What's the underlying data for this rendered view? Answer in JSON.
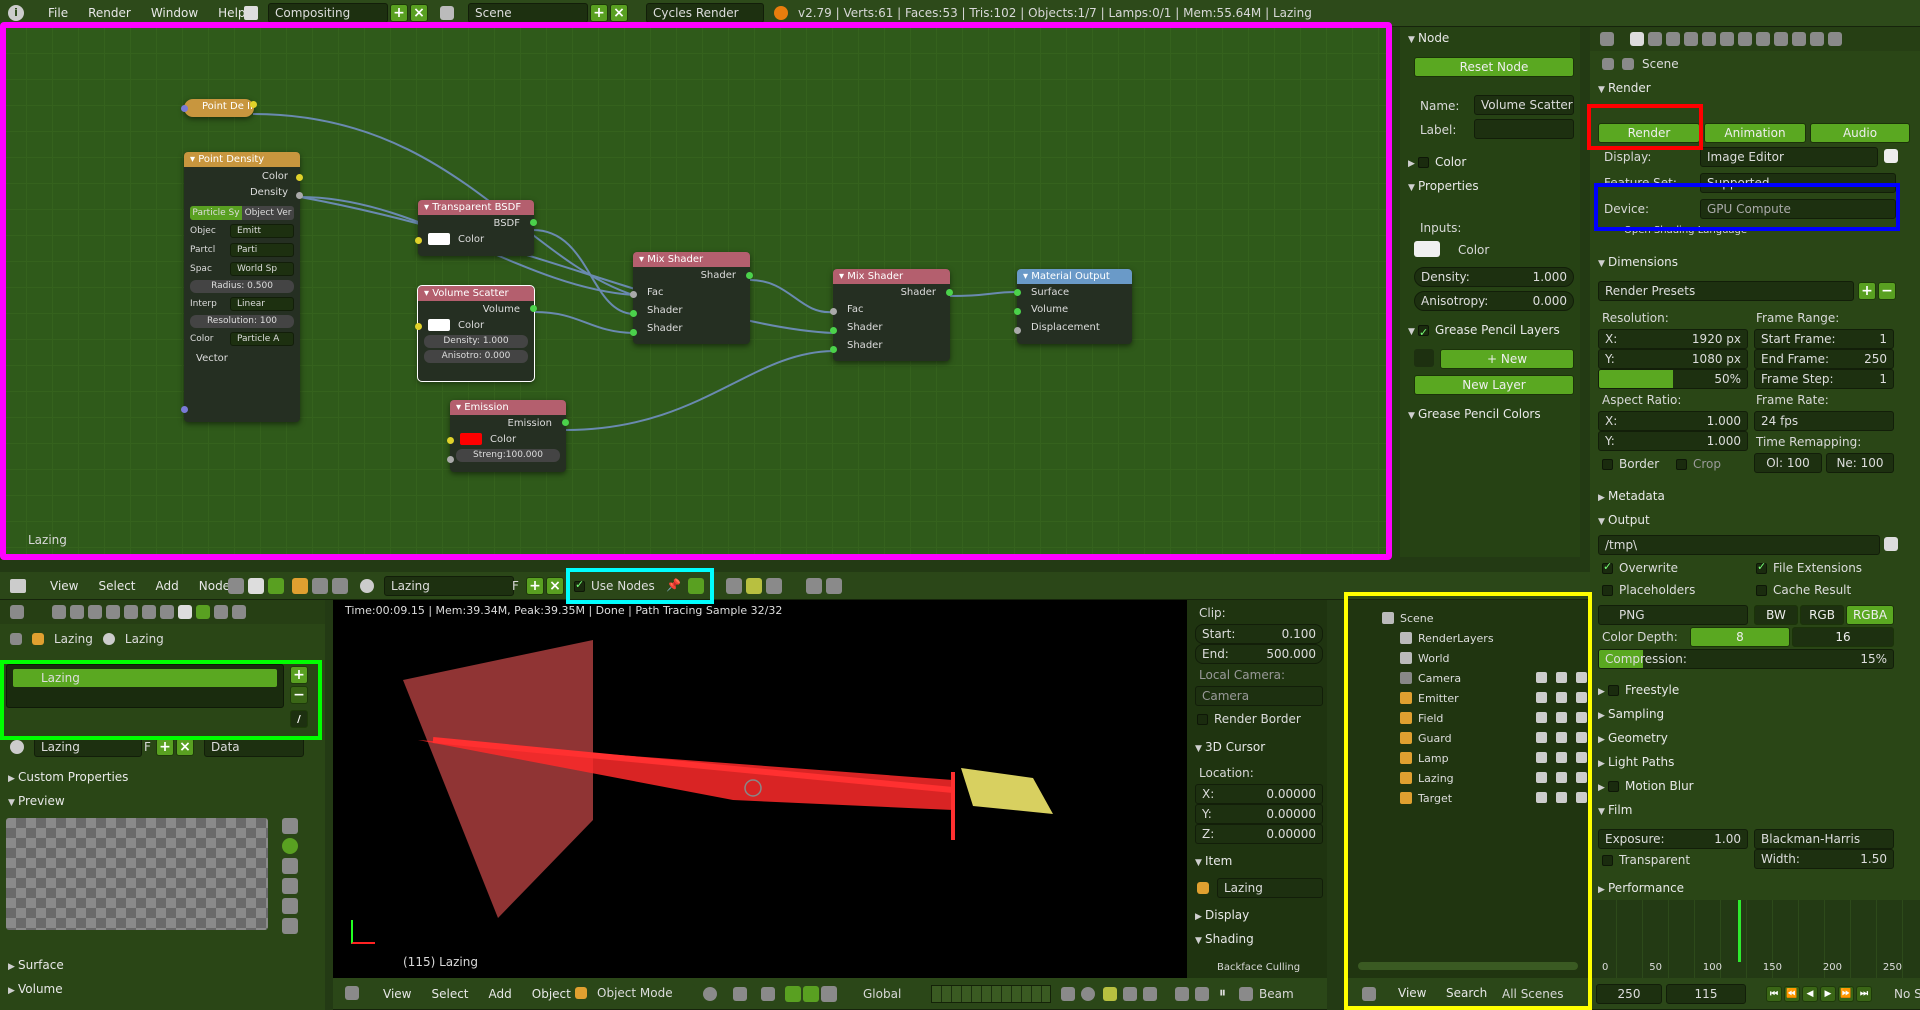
{
  "topbar": {
    "menus": [
      "File",
      "Render",
      "Window",
      "Help"
    ],
    "workspace": "Compositing",
    "scene": "Scene",
    "engine": "Cycles Render",
    "stats": "v2.79 | Verts:61 | Faces:53 | Tris:102 | Objects:1/7 | Lamps:0/1 | Mem:55.64M | Lazing"
  },
  "node_editor": {
    "label": "Lazing",
    "nodes": {
      "point_density_small": {
        "title": "Point De II"
      },
      "point_density": {
        "title": "Point Density",
        "out_color": "Color",
        "out_density": "Density",
        "tab_a": "Particle Sy",
        "tab_b": "Object Ver",
        "f_object_lbl": "Objec",
        "f_object": "Emitt",
        "f_particle_lbl": "Partcl",
        "f_particle": "Parti",
        "f_space_lbl": "Spac",
        "f_space": "World Sp",
        "radius": "Radius:   0.500",
        "interp_lbl": "Interp",
        "interp": "Linear",
        "resolution": "Resolution: 100",
        "color_lbl": "Color",
        "color": "Particle A",
        "in_vector": "Vector"
      },
      "transparent": {
        "title": "Transparent BSDF",
        "out": "BSDF",
        "in_color": "Color"
      },
      "volume_scatter": {
        "title": "Volume Scatter",
        "out": "Volume",
        "in_color": "Color",
        "density": "Density:  1.000",
        "anisotropy": "Anisotro: 0.000"
      },
      "emission": {
        "title": "Emission",
        "out": "Emission",
        "in_color": "Color",
        "strength": "Streng:100.000"
      },
      "mix1": {
        "title": "Mix Shader",
        "out": "Shader",
        "in_fac": "Fac",
        "in_s1": "Shader",
        "in_s2": "Shader"
      },
      "mix2": {
        "title": "Mix Shader",
        "out": "Shader",
        "in_fac": "Fac",
        "in_s1": "Shader",
        "in_s2": "Shader"
      },
      "output": {
        "title": "Material Output",
        "in_surface": "Surface",
        "in_volume": "Volume",
        "in_disp": "Displacement"
      }
    }
  },
  "node_props": {
    "title": "Node",
    "reset": "Reset Node",
    "name_lbl": "Name:",
    "name": "Volume Scatter",
    "label_lbl": "Label:",
    "color": "Color",
    "properties": "Properties",
    "inputs": "Inputs:",
    "in_color": "Color",
    "density": "Density:",
    "density_val": "1.000",
    "aniso": "Anisotropy:",
    "aniso_val": "0.000",
    "gp_layers": "Grease Pencil Layers",
    "new": "New",
    "new_layer": "New Layer",
    "gp_colors": "Grease Pencil Colors"
  },
  "node_header": {
    "menus": [
      "View",
      "Select",
      "Add",
      "Node"
    ],
    "material": "Lazing",
    "f": "F",
    "use_nodes": "Use Nodes"
  },
  "mat_panel": {
    "breadcrumb": [
      "Lazing",
      "Lazing"
    ],
    "slot": "Lazing",
    "mat": "Lazing",
    "f": "F",
    "data": "Data",
    "custom": "Custom Properties",
    "preview": "Preview",
    "surface": "Surface",
    "volume": "Volume"
  },
  "viewport": {
    "status": "Time:00:09.15 | Mem:39.34M, Peak:39.35M | Done | Path Tracing Sample 32/32",
    "label": "(115) Lazing",
    "menus": [
      "View",
      "Select",
      "Add",
      "Object"
    ],
    "mode": "Object Mode",
    "orient": "Global",
    "beam": "Beam"
  },
  "view_props": {
    "clip": "Clip:",
    "start": "Start:",
    "start_val": "0.100",
    "end": "End:",
    "end_val": "500.000",
    "local_cam": "Local Camera:",
    "camera": "Camera",
    "render_border": "Render Border",
    "cursor": "3D Cursor",
    "location": "Location:",
    "x": "X:",
    "xv": "0.00000",
    "y": "Y:",
    "yv": "0.00000",
    "z": "Z:",
    "zv": "0.00000",
    "item": "Item",
    "item_name": "Lazing",
    "display": "Display",
    "shading": "Shading",
    "bf": "Backface Culling"
  },
  "outliner": {
    "items": [
      {
        "name": "Scene",
        "depth": 0
      },
      {
        "name": "RenderLayers",
        "depth": 1
      },
      {
        "name": "World",
        "depth": 1
      },
      {
        "name": "Camera",
        "depth": 1
      },
      {
        "name": "Emitter",
        "depth": 1
      },
      {
        "name": "Field",
        "depth": 1
      },
      {
        "name": "Guard",
        "depth": 1
      },
      {
        "name": "Lamp",
        "depth": 1
      },
      {
        "name": "Lazing",
        "depth": 1
      },
      {
        "name": "Target",
        "depth": 1
      }
    ],
    "menus": [
      "View",
      "Search"
    ],
    "filter": "All Scenes"
  },
  "props": {
    "scene": "Scene",
    "render": "Render",
    "render_btn": "Render",
    "anim_btn": "Animation",
    "audio_btn": "Audio",
    "display_lbl": "Display:",
    "display": "Image Editor",
    "feature_lbl": "Feature Set:",
    "feature": "Supported",
    "device_lbl": "Device:",
    "device": "GPU Compute",
    "osl": "Open Shading Language",
    "dimensions": "Dimensions",
    "presets": "Render Presets",
    "res": "Resolution:",
    "resx": "X:",
    "resxv": "1920 px",
    "resy": "Y:",
    "resyv": "1080 px",
    "pct": "50%",
    "frange": "Frame Range:",
    "fstart": "Start Frame:",
    "fstartv": "1",
    "fend": "End Frame:",
    "fendv": "250",
    "fstep": "Frame Step:",
    "fstepv": "1",
    "aspect": "Aspect Ratio:",
    "ax": "X:",
    "axv": "1.000",
    "ay": "Y:",
    "ayv": "1.000",
    "frate": "Frame Rate:",
    "fps": "24 fps",
    "remap": "Time Remapping:",
    "old": "Ol: 100",
    "new": "Ne: 100",
    "border": "Border",
    "crop": "Crop",
    "metadata": "Metadata",
    "output": "Output",
    "path": "/tmp\\",
    "overwrite": "Overwrite",
    "fileext": "File Extensions",
    "placeholders": "Placeholders",
    "cache": "Cache Result",
    "format": "PNG",
    "bw": "BW",
    "rgb": "RGB",
    "rgba": "RGBA",
    "depth_lbl": "Color Depth:",
    "d8": "8",
    "d16": "16",
    "compression": "Compression:",
    "comp_val": "15%",
    "freestyle": "Freestyle",
    "sampling": "Sampling",
    "geometry": "Geometry",
    "lightpaths": "Light Paths",
    "motionblur": "Motion Blur",
    "film": "Film",
    "exposure": "Exposure:",
    "exposure_val": "1.00",
    "filter": "Blackman-Harris",
    "transparent": "Transparent",
    "width": "Width:",
    "width_val": "1.50",
    "performance": "Performance"
  },
  "timeline": {
    "ticks": [
      "0",
      "50",
      "100",
      "150",
      "200",
      "250"
    ],
    "end": "250",
    "current": "115",
    "nosync": "No S"
  },
  "colors": {
    "magenta": "#ff00ff",
    "red": "#ff0000",
    "blue": "#0000ff",
    "cyan": "#00ffff",
    "green": "#00ff00",
    "yellow": "#ffff00"
  }
}
